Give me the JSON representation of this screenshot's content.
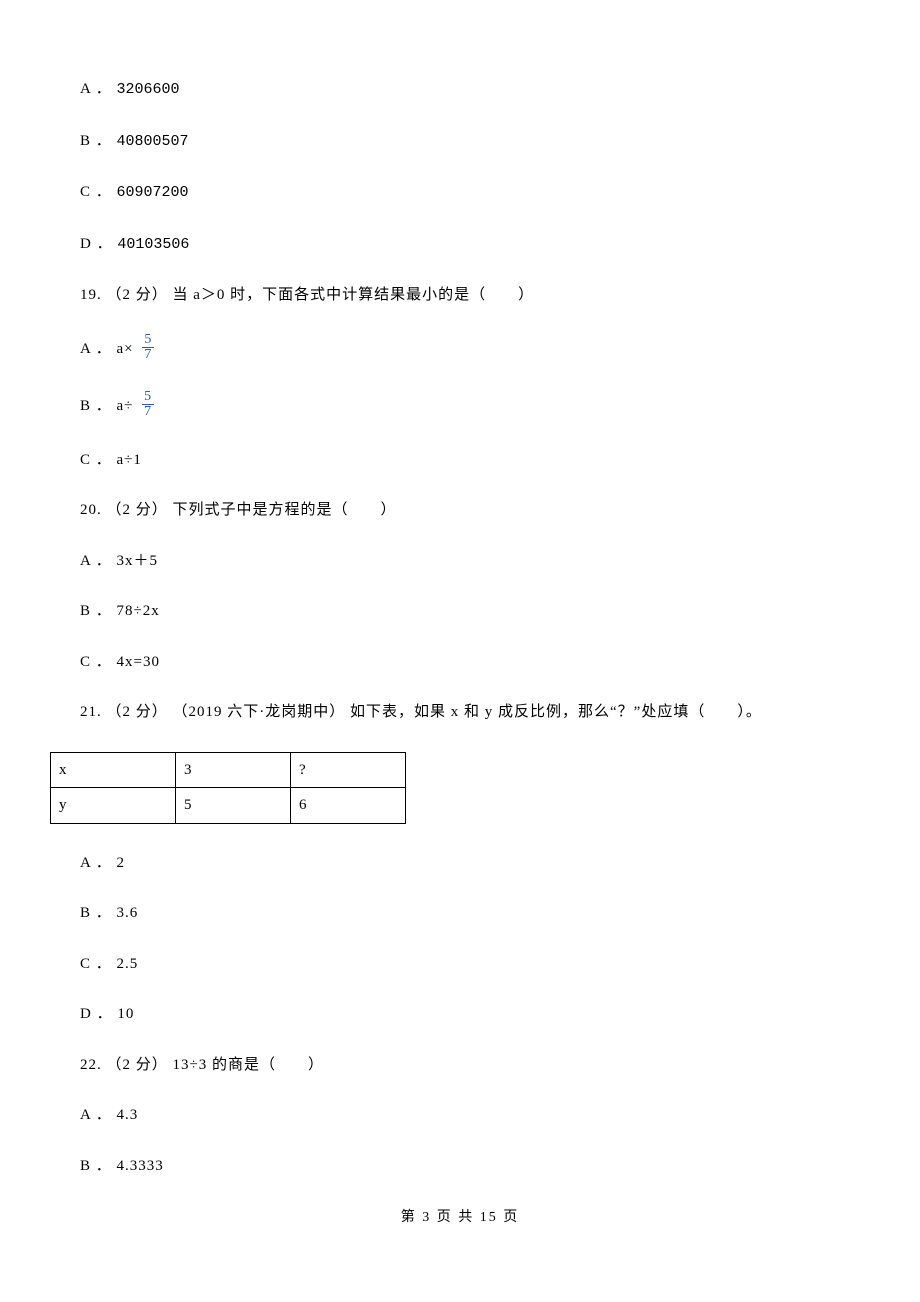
{
  "q18": {
    "options": {
      "A": "3206600",
      "B": "40800507",
      "C": "60907200",
      "D": "40103506"
    }
  },
  "q19": {
    "number": "19.",
    "points": "（2 分）",
    "stem": " 当 a＞0 时，下面各式中计算结果最小的是（　　）",
    "options": {
      "A_prefix": "a×",
      "A_num": "5",
      "A_den": "7",
      "B_prefix": "a÷",
      "B_num": "5",
      "B_den": "7",
      "C": "a÷1"
    }
  },
  "q20": {
    "number": "20.",
    "points": "（2 分）",
    "stem": " 下列式子中是方程的是（　　）",
    "options": {
      "A": "3x＋5",
      "B": "78÷2x",
      "C": "4x=30"
    }
  },
  "q21": {
    "number": "21.",
    "points": "（2 分）",
    "source": "（2019 六下·龙岗期中）",
    "stem": "如下表，如果 x 和 y 成反比例，那么“？”处应填（　　）。",
    "table": {
      "row1": [
        "x",
        "3",
        "?"
      ],
      "row2": [
        "y",
        "5",
        "6"
      ]
    },
    "options": {
      "A": "2",
      "B": "3.6",
      "C": "2.5",
      "D": "10"
    }
  },
  "q22": {
    "number": "22.",
    "points": "（2 分）",
    "stem": " 13÷3 的商是（　　）",
    "options": {
      "A": "4.3",
      "B": "4.3333"
    }
  },
  "labels": {
    "A": "A ．",
    "B": "B ．",
    "C": "C ．",
    "D": "D ．"
  },
  "footer": "第 3 页 共 15 页"
}
